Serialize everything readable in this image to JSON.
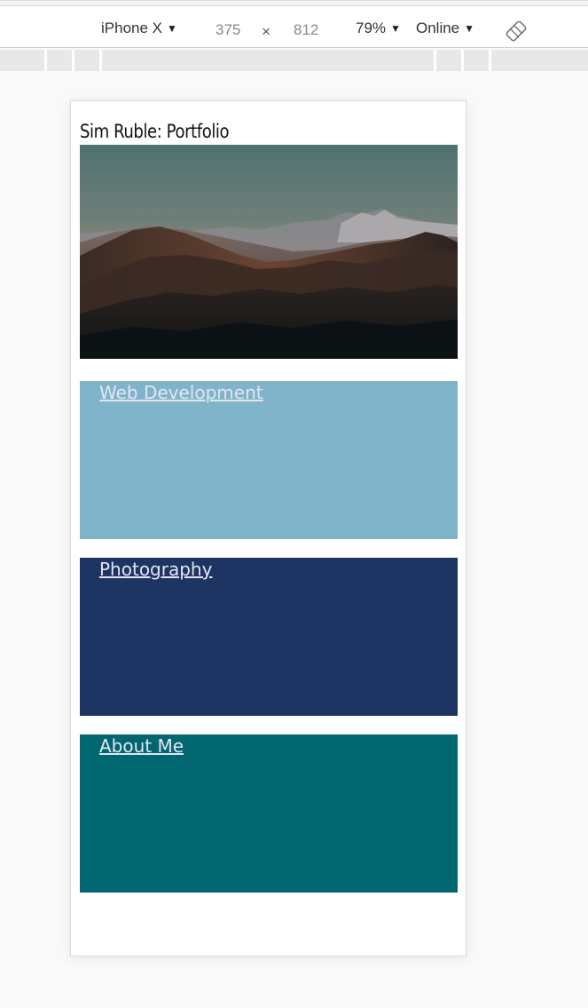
{
  "devtools": {
    "device_name": "iPhone X",
    "width": "375",
    "separator": "×",
    "height": "812",
    "zoom": "79%",
    "network": "Online",
    "caret": "▼",
    "rotate_icon": "rotate-icon"
  },
  "site": {
    "title": "Sim Ruble: Portfolio",
    "hero_image": "mountain-landscape-photo",
    "sections": [
      {
        "label": "Web Development",
        "color": "#7fb4cb"
      },
      {
        "label": "Photography",
        "color": "#1e3563"
      },
      {
        "label": "About Me",
        "color": "#006770"
      }
    ]
  }
}
